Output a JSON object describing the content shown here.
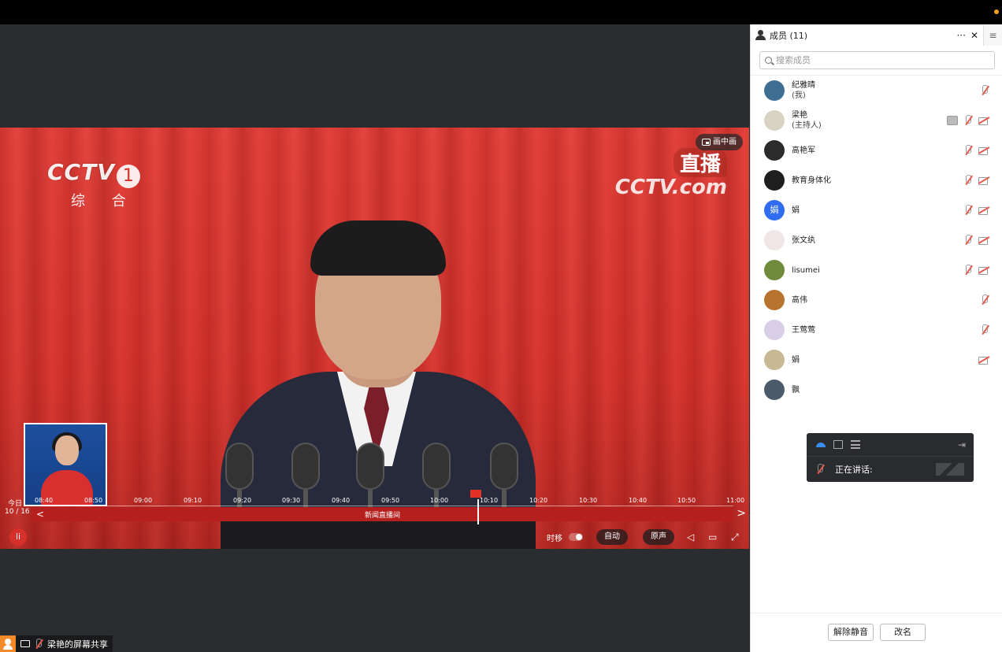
{
  "share_area": {
    "channel": {
      "brand": "CCTV",
      "number": "1",
      "sub": "综 合"
    },
    "live": {
      "label": "直播",
      "site": "CCTV.com"
    },
    "pip_label": "画中画",
    "timeline": {
      "today": "今日",
      "date": "10 / 16",
      "ticks": [
        "08:40",
        "08:50",
        "09:00",
        "09:10",
        "09:20",
        "09:30",
        "09:40",
        "09:50",
        "10:00",
        "10:10",
        "10:20",
        "10:30",
        "10:40",
        "10:50",
        "11:00"
      ],
      "program": "新闻直播间"
    },
    "controls": {
      "timeshift": "时移",
      "auto": "自动",
      "original": "原声"
    }
  },
  "share_label": "梁艳的屏幕共享",
  "panel": {
    "title": "成员 (11)",
    "more": "···",
    "close": "✕",
    "menu": "≡",
    "search_placeholder": "搜索成员",
    "members": [
      {
        "name": "纪雅晴",
        "role": "(我)",
        "avatar_color": "#3f6e95",
        "avatar_text": "",
        "mic_off": true,
        "cam_off": false,
        "sharing": false
      },
      {
        "name": "梁艳",
        "role": "(主持人)",
        "avatar_color": "#d9d3c4",
        "avatar_text": "",
        "mic_off": true,
        "cam_off": true,
        "sharing": true
      },
      {
        "name": "高艳军",
        "role": "",
        "avatar_color": "#2b2b2b",
        "avatar_text": "",
        "mic_off": true,
        "cam_off": true,
        "sharing": false
      },
      {
        "name": "教育身体化",
        "role": "",
        "avatar_color": "#1e1e1e",
        "avatar_text": "",
        "mic_off": true,
        "cam_off": true,
        "sharing": false
      },
      {
        "name": "娟",
        "role": "",
        "avatar_color": "#2f6cf0",
        "avatar_text": "娟",
        "mic_off": true,
        "cam_off": true,
        "sharing": false
      },
      {
        "name": "张文纨",
        "role": "",
        "avatar_color": "#f1e6e6",
        "avatar_text": "",
        "mic_off": true,
        "cam_off": true,
        "sharing": false
      },
      {
        "name": "lisumei",
        "role": "",
        "avatar_color": "#6e8a3a",
        "avatar_text": "",
        "mic_off": true,
        "cam_off": true,
        "sharing": false
      },
      {
        "name": "高伟",
        "role": "",
        "avatar_color": "#b8742e",
        "avatar_text": "",
        "mic_off": true,
        "cam_off": false,
        "sharing": false
      },
      {
        "name": "王莺莺",
        "role": "",
        "avatar_color": "#d8cfe6",
        "avatar_text": "",
        "mic_off": true,
        "cam_off": false,
        "sharing": false
      },
      {
        "name": "娟",
        "role": "",
        "avatar_color": "#c9b894",
        "avatar_text": "",
        "mic_off": false,
        "cam_off": true,
        "sharing": false
      },
      {
        "name": "飘",
        "role": "",
        "avatar_color": "#4b5b6c",
        "avatar_text": "",
        "mic_off": false,
        "cam_off": false,
        "sharing": false
      }
    ],
    "buttons": {
      "unmute": "解除静音",
      "rename": "改名"
    }
  },
  "speaking": {
    "label": "正在讲话:"
  },
  "colors": {
    "accent": "#2f6cf0",
    "video_red": "#d7302a",
    "topbar": "#000000",
    "panel_bg": "#ffffff"
  }
}
